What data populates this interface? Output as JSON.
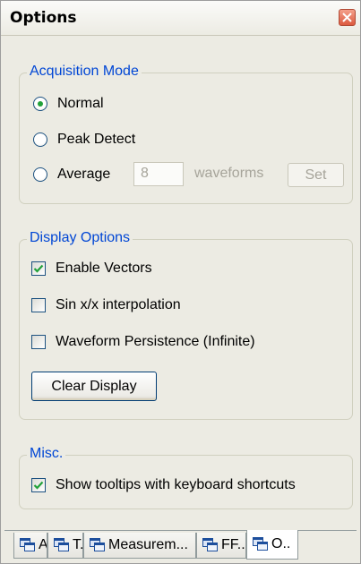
{
  "window": {
    "title": "Options",
    "close_icon": "close-icon"
  },
  "acquisition": {
    "legend": "Acquisition Mode",
    "options": [
      {
        "label": "Normal",
        "selected": true
      },
      {
        "label": "Peak Detect",
        "selected": false
      },
      {
        "label": "Average",
        "selected": false
      }
    ],
    "average_count": "8",
    "average_unit": "waveforms",
    "set_label": "Set"
  },
  "display": {
    "legend": "Display Options",
    "options": [
      {
        "label": "Enable Vectors",
        "checked": true
      },
      {
        "label": "Sin x/x interpolation",
        "checked": false
      },
      {
        "label": "Waveform Persistence (Infinite)",
        "checked": false
      }
    ],
    "clear_label": "Clear Display"
  },
  "misc": {
    "legend": "Misc.",
    "options": [
      {
        "label": "Show tooltips with keyboard shortcuts",
        "checked": true
      }
    ]
  },
  "tabs": [
    {
      "label": "A.",
      "active": false
    },
    {
      "label": "T.",
      "active": false
    },
    {
      "label": "Measurem...",
      "active": false
    },
    {
      "label": "FF...",
      "active": false
    },
    {
      "label": "O..",
      "active": true
    }
  ],
  "colors": {
    "accent": "#0046d5",
    "check": "#22a13a",
    "close": "#dc5a3f"
  }
}
